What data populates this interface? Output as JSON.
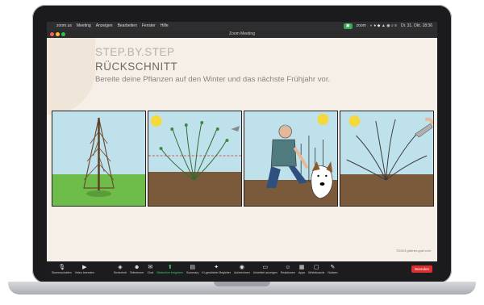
{
  "menubar": {
    "app": "zoom.us",
    "items": [
      "Meeting",
      "Anzeigen",
      "Bearbeiten",
      "Fenster",
      "Hilfe"
    ],
    "zoom_tag": "zoom",
    "datetime": "Di. 31. Okt.  18:36"
  },
  "window": {
    "title": "Zoom Meeting"
  },
  "slide": {
    "heading1": "STEP.BY.STEP",
    "heading2": "RÜCKSCHNITT",
    "subtitle": "Bereite deine Pflanzen auf den Winter und das nächste Frühjahr vor.",
    "copyright": "©2023 gärtner-graf.com"
  },
  "toolbar": {
    "items": [
      {
        "label": "Stummschalten",
        "icon": "microphone-icon"
      },
      {
        "label": "Video beenden",
        "icon": "video-camera-icon"
      },
      {
        "label": "Sicherheit",
        "icon": "shield-icon"
      },
      {
        "label": "Teilnehmer",
        "icon": "participants-icon"
      },
      {
        "label": "Chat",
        "icon": "chat-icon"
      },
      {
        "label": "Bildschirm freigeben",
        "icon": "share-screen-icon"
      },
      {
        "label": "Summary",
        "icon": "summary-icon"
      },
      {
        "label": "KI-gestützter Begleiter",
        "icon": "ai-companion-icon"
      },
      {
        "label": "Aufzeichnen",
        "icon": "record-icon"
      },
      {
        "label": "Untertitel anzeigen",
        "icon": "captions-icon"
      },
      {
        "label": "Reaktionen",
        "icon": "reactions-icon"
      },
      {
        "label": "Apps",
        "icon": "apps-icon"
      },
      {
        "label": "Whiteboards",
        "icon": "whiteboard-icon"
      },
      {
        "label": "Notizen",
        "icon": "notes-icon"
      }
    ],
    "end_label": "Beenden"
  },
  "colors": {
    "share_active": "#3ac66a",
    "end_button": "#e02e2e",
    "slide_bg": "#f6efe7"
  }
}
